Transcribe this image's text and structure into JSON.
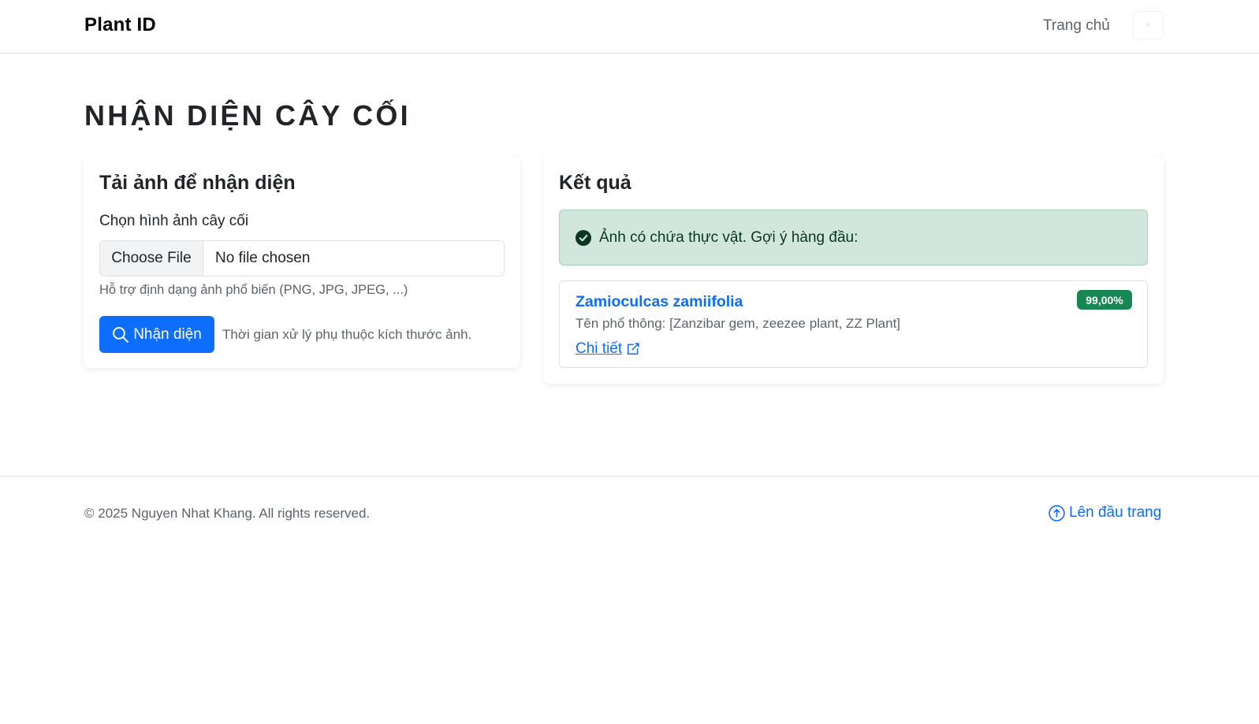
{
  "navbar": {
    "brand": "Plant ID",
    "home_link": "Trang chủ",
    "theme_toggle": "☀"
  },
  "page": {
    "title": "NHẬN DIỆN CÂY CỐI"
  },
  "upload_card": {
    "title": "Tải ảnh để nhận diện",
    "file_label": "Chọn hình ảnh cây cối",
    "file_button": "Choose File",
    "file_status": "No file chosen",
    "help_text": "Hỗ trợ định dạng ảnh phổ biến (PNG, JPG, JPEG, ...)",
    "submit_label": "Nhận diện",
    "submit_hint": "Thời gian xử lý phụ thuộc kích thước ảnh."
  },
  "result_card": {
    "title": "Kết quả",
    "alert_text": "Ảnh có chứa thực vật. Gợi ý hàng đầu:",
    "results": [
      {
        "scientific_name": "Zamioculcas zamiifolia",
        "confidence": "99,00%",
        "common_names": "Tên phổ thông: [Zanzibar gem, zeezee plant, ZZ Plant]",
        "detail_link": "Chi tiết"
      }
    ]
  },
  "footer": {
    "copyright": "© 2025 Nguyen Nhat Khang. All rights reserved.",
    "back_to_top": "Lên đầu trang"
  },
  "colors": {
    "primary": "#0d6efd",
    "success_badge": "#198754",
    "alert_bg": "#d1e7dd",
    "alert_text": "#0a3622",
    "muted": "#5c636a"
  },
  "icons": {
    "submit": "search-icon",
    "alert": "check-circle-icon",
    "detail": "external-link-icon",
    "back_to_top": "arrow-up-circle-icon"
  }
}
